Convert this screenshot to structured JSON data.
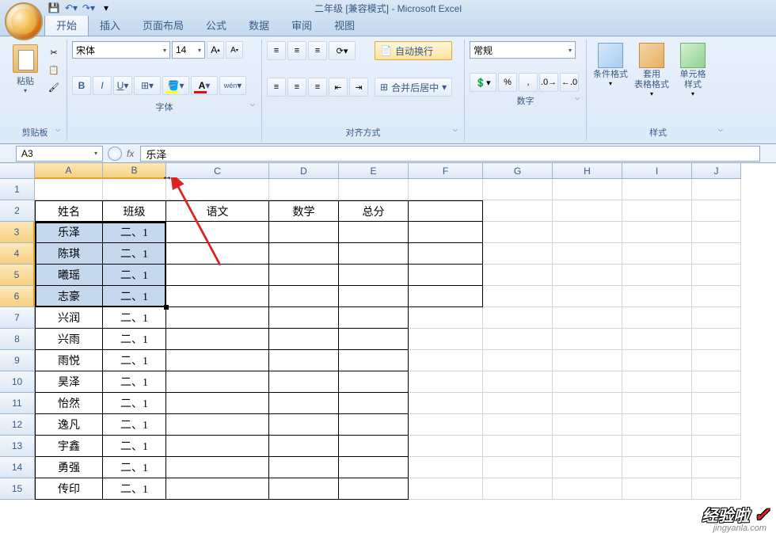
{
  "app": {
    "title": "二年级  [兼容模式] - Microsoft Excel"
  },
  "tabs": {
    "home": "开始",
    "insert": "插入",
    "layout": "页面布局",
    "formula": "公式",
    "data": "数据",
    "review": "审阅",
    "view": "视图"
  },
  "ribbon": {
    "clipboard": {
      "paste": "粘贴",
      "label": "剪贴板"
    },
    "font": {
      "name": "宋体",
      "size": "14",
      "grow": "A",
      "shrink": "A",
      "label": "字体"
    },
    "alignment": {
      "wrap": "自动换行",
      "merge": "合并后居中",
      "label": "对齐方式"
    },
    "number": {
      "format": "常规",
      "label": "数字"
    },
    "styles": {
      "cond": "条件格式",
      "table": "套用\n表格格式",
      "cell": "单元格\n样式",
      "label": "样式"
    }
  },
  "formulaBar": {
    "name": "A3",
    "value": "乐泽"
  },
  "columns": [
    "A",
    "B",
    "C",
    "D",
    "E",
    "F",
    "G",
    "H",
    "I",
    "J"
  ],
  "rows": [
    "1",
    "2",
    "3",
    "4",
    "5",
    "6",
    "7",
    "8",
    "9",
    "10",
    "11",
    "12",
    "13",
    "14",
    "15"
  ],
  "headerRow": {
    "name": "姓名",
    "class": "班级",
    "chinese": "语文",
    "math": "数学",
    "total": "总分"
  },
  "students": [
    {
      "name": "乐泽",
      "class": "二、1"
    },
    {
      "name": "陈琪",
      "class": "二、1"
    },
    {
      "name": "曦瑶",
      "class": "二、1"
    },
    {
      "name": "志豪",
      "class": "二、1"
    },
    {
      "name": "兴润",
      "class": "二、1"
    },
    {
      "name": "兴雨",
      "class": "二、1"
    },
    {
      "name": "雨悦",
      "class": "二、1"
    },
    {
      "name": "昊泽",
      "class": "二、1"
    },
    {
      "name": "怡然",
      "class": "二、1"
    },
    {
      "name": "逸凡",
      "class": "二、1"
    },
    {
      "name": "宇鑫",
      "class": "二、1"
    },
    {
      "name": "勇强",
      "class": "二、1"
    },
    {
      "name": "传印",
      "class": "二、1"
    }
  ],
  "watermark": {
    "text": "经验啦",
    "check": "✓",
    "sub": "jingyanla.com"
  }
}
